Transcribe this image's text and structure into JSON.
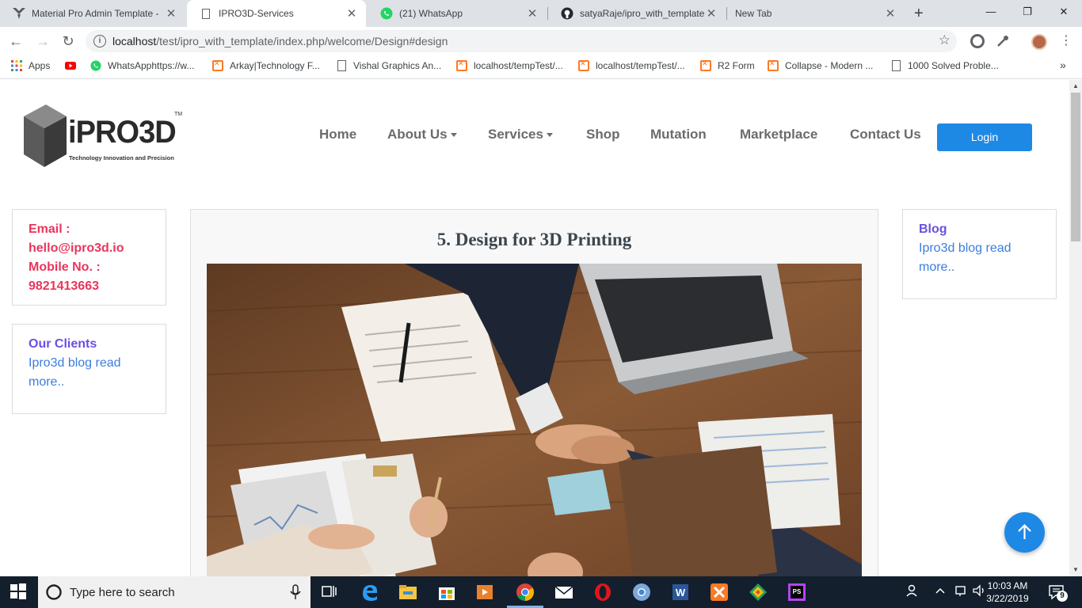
{
  "browser": {
    "tabs": [
      {
        "title": "Material Pro Admin Template -",
        "icon": "material-pro-icon"
      },
      {
        "title": "IPRO3D-Services",
        "icon": "page-icon",
        "active": true
      },
      {
        "title": "(21) WhatsApp",
        "icon": "whatsapp-icon"
      },
      {
        "title": "satyaRaje/ipro_with_template",
        "icon": "github-icon"
      },
      {
        "title": "New Tab",
        "icon": ""
      }
    ],
    "close_glyph": "✕",
    "newtab_glyph": "+",
    "address": {
      "host": "localhost",
      "path": "/test/ipro_with_template/index.php/welcome/Design#design"
    },
    "bookmarks": [
      {
        "label": "Apps",
        "icon": "apps-grid-icon"
      },
      {
        "label": "",
        "icon": "youtube-icon"
      },
      {
        "label": "WhatsApphttps://w...",
        "icon": "whatsapp-icon"
      },
      {
        "label": "Arkay|Technology F...",
        "icon": "xampp-icon"
      },
      {
        "label": "Vishal Graphics An...",
        "icon": "page-icon"
      },
      {
        "label": "localhost/tempTest/...",
        "icon": "xampp-icon"
      },
      {
        "label": "localhost/tempTest/...",
        "icon": "xampp-icon"
      },
      {
        "label": "R2 Form",
        "icon": "xampp-icon"
      },
      {
        "label": "Collapse - Modern ...",
        "icon": "xampp-icon"
      },
      {
        "label": "1000 Solved Proble...",
        "icon": "page-icon"
      }
    ],
    "more_bookmarks": "»"
  },
  "site": {
    "logo": {
      "word": "iPRO3D",
      "tm": "TM",
      "tagline": "Technology Innovation and Precision"
    },
    "nav": [
      {
        "label": "Home",
        "dropdown": false
      },
      {
        "label": "About Us",
        "dropdown": true
      },
      {
        "label": "Services",
        "dropdown": true
      },
      {
        "label": "Shop",
        "dropdown": false
      },
      {
        "label": "Mutation",
        "dropdown": false
      },
      {
        "label": "Marketplace",
        "dropdown": false
      },
      {
        "label": "Contact Us",
        "dropdown": false
      }
    ],
    "login_label": "Login",
    "contact": {
      "email_label": "Email :",
      "email": "hello@ipro3d.io",
      "mobile_label": "Mobile No. :",
      "mobile": "9821413663"
    },
    "clients": {
      "title": "Our Clients",
      "text": "Ipro3d blog read more.."
    },
    "blog": {
      "title": "Blog",
      "text": "Ipro3d blog read more.."
    },
    "main": {
      "title": "5. Design for 3D Printing"
    },
    "colors": {
      "accent": "#1e88e5",
      "contact": "#e8365d",
      "card_title": "#6b4fe0",
      "link": "#3a7de0"
    }
  },
  "taskbar": {
    "search_placeholder": "Type here to search",
    "time": "10:03 AM",
    "date": "3/22/2019",
    "notifications": "9"
  }
}
